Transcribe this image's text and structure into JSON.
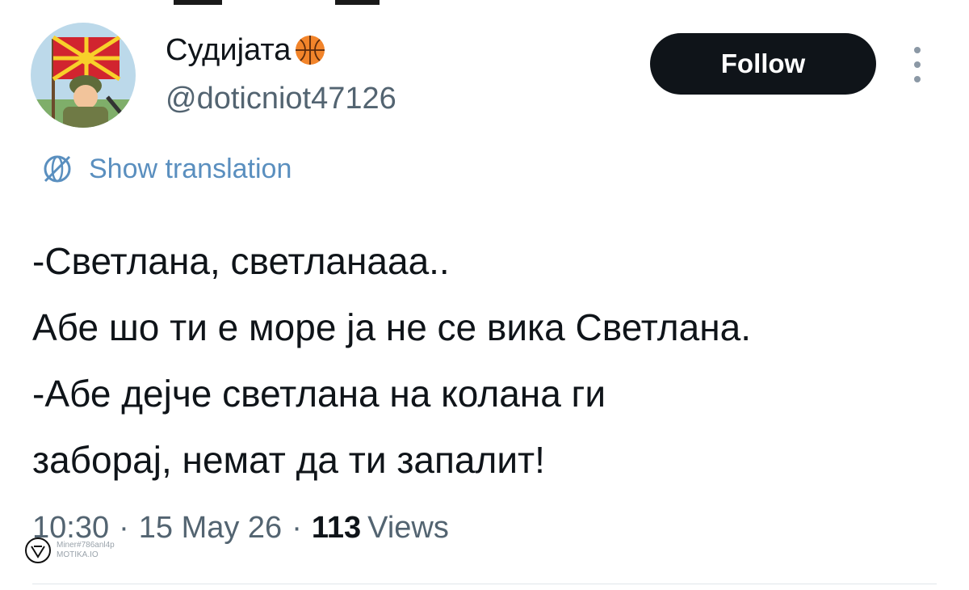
{
  "author": {
    "display_name": "Судијата",
    "name_emoji": "basketball-icon",
    "handle": "@doticniot47126"
  },
  "follow_label": "Follow",
  "translate_label": "Show translation",
  "tweet": {
    "lines": [
      "-Светлана, светланааа..",
      "Абе шо ти е море ја не се вика Светлана.",
      "-Абе дејче светлана на колана ги",
      "заборај, немат да ти запалит!"
    ]
  },
  "meta": {
    "time": "10:30",
    "date": "15 May 26",
    "separator": "·",
    "views_count": "113",
    "views_label": "Views"
  },
  "watermark": {
    "line1": "Miner#786anl4p",
    "line2": "MOTIKA.IO"
  },
  "colors": {
    "follow_bg": "#0f1419",
    "link": "#5a8fbf",
    "secondary_text": "#536471",
    "flag_red": "#d1242f",
    "flag_yellow": "#f8d02a"
  }
}
